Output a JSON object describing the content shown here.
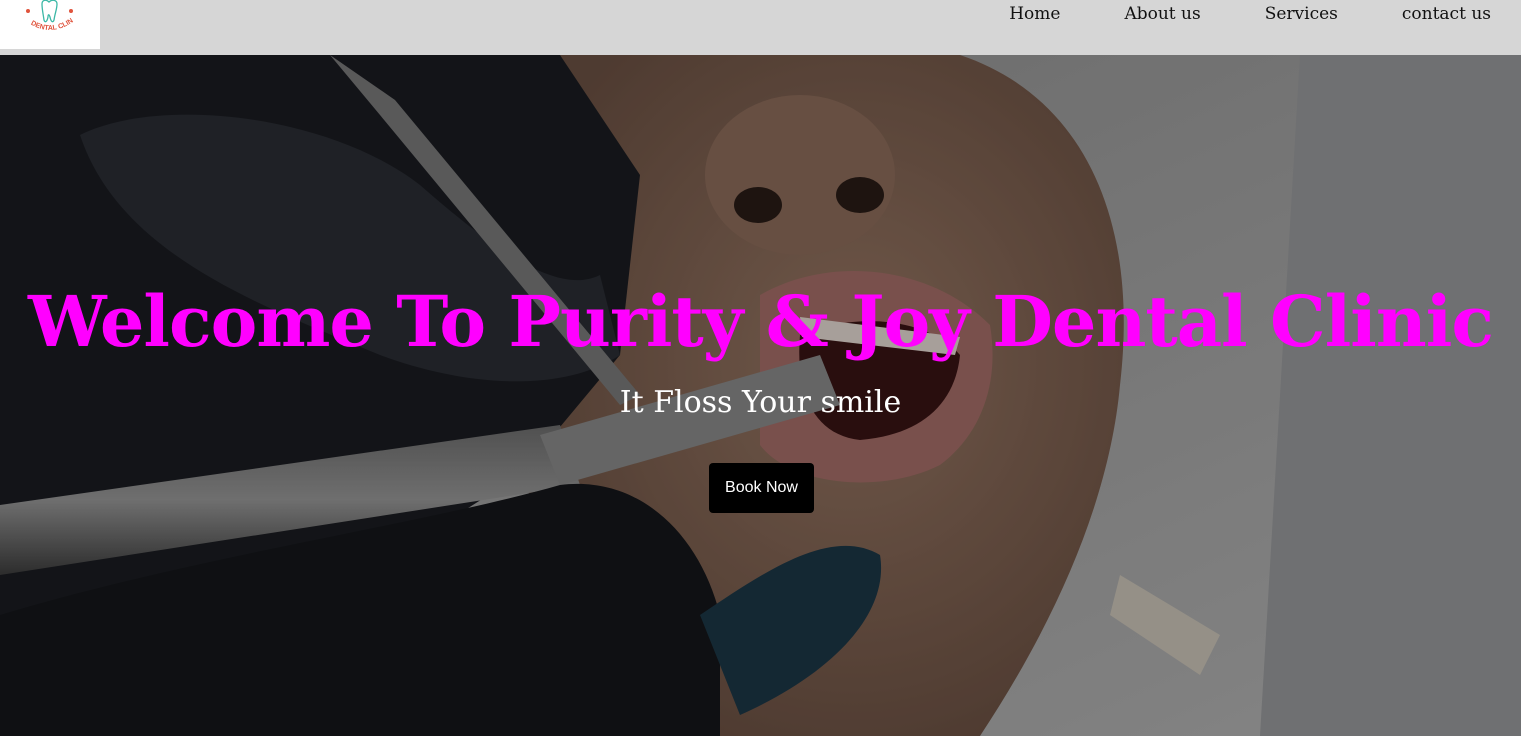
{
  "nav": {
    "logo_text": "DENTAL CLINIC",
    "links": [
      "Home",
      "About us",
      "Services",
      "contact us"
    ]
  },
  "hero": {
    "title": "Welcome To Purity & Joy Dental Clinic",
    "subtitle": "It Floss Your smile",
    "button_label": "Book Now"
  },
  "colors": {
    "navbar_bg": "#d6d6d6",
    "title": "#ff00ff",
    "button_bg": "#000000"
  }
}
